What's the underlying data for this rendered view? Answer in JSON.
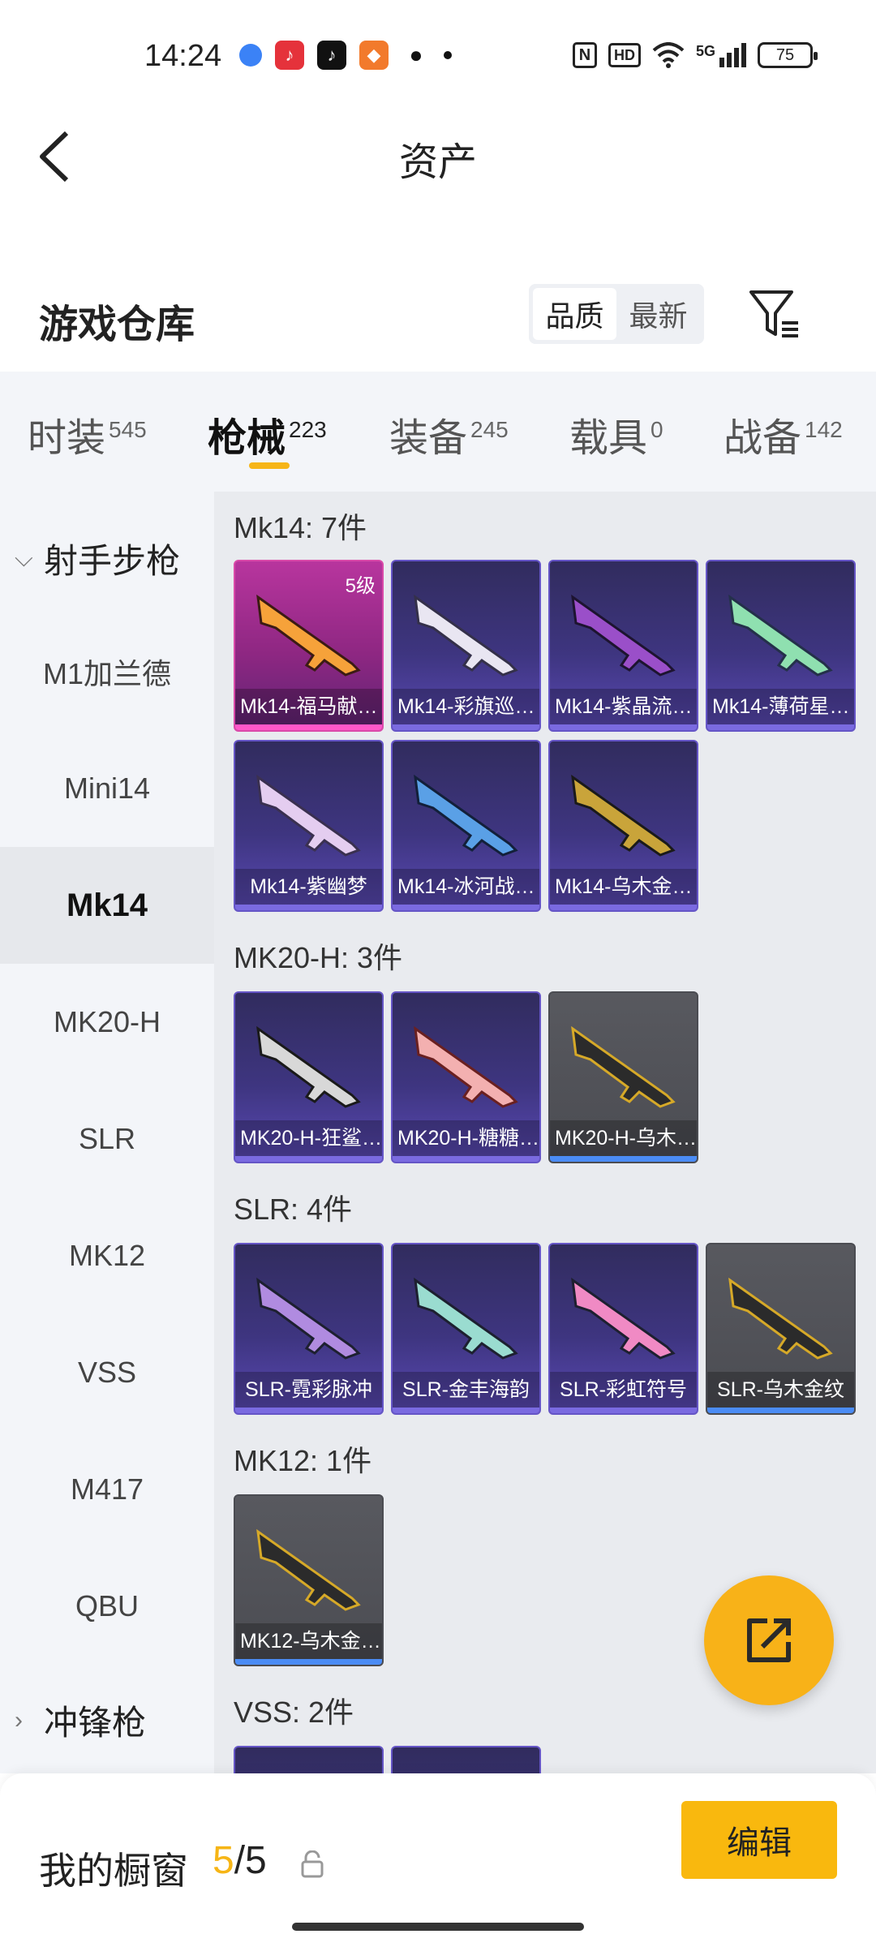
{
  "status": {
    "time": "14:24",
    "network": "5G",
    "hd": "HD",
    "nfc": "N",
    "battery": "75"
  },
  "nav": {
    "title": "资产"
  },
  "warehouse": {
    "title": "游戏仓库",
    "sort_quality": "品质",
    "sort_latest": "最新"
  },
  "tabs": [
    {
      "label": "时装",
      "count": "545"
    },
    {
      "label": "枪械",
      "count": "223"
    },
    {
      "label": "装备",
      "count": "245"
    },
    {
      "label": "载具",
      "count": "0"
    },
    {
      "label": "战备",
      "count": "142"
    }
  ],
  "sidebar": {
    "group_marksman": "射手步枪",
    "items": [
      "M1加兰德",
      "Mini14",
      "Mk14",
      "MK20-H",
      "SLR",
      "MK12",
      "VSS",
      "M417",
      "QBU"
    ],
    "group_smg": "冲锋枪"
  },
  "sections": [
    {
      "title": "Mk14: 7件",
      "cards": [
        {
          "name": "Mk14-福马献…",
          "level": "5级",
          "rarity": "pink"
        },
        {
          "name": "Mk14-彩旗巡…",
          "rarity": "purple"
        },
        {
          "name": "Mk14-紫晶流…",
          "rarity": "purple"
        },
        {
          "name": "Mk14-薄荷星…",
          "rarity": "purple"
        },
        {
          "name": "Mk14-紫幽梦",
          "rarity": "purple"
        },
        {
          "name": "Mk14-冰河战…",
          "rarity": "purple"
        },
        {
          "name": "Mk14-乌木金…",
          "rarity": "purple"
        }
      ]
    },
    {
      "title": "MK20-H: 3件",
      "cards": [
        {
          "name": "MK20-H-狂鲨…",
          "rarity": "purple"
        },
        {
          "name": "MK20-H-糖糖…",
          "rarity": "purple"
        },
        {
          "name": "MK20-H-乌木…",
          "rarity": "grey"
        }
      ]
    },
    {
      "title": "SLR: 4件",
      "cards": [
        {
          "name": "SLR-霓彩脉冲",
          "rarity": "purple"
        },
        {
          "name": "SLR-金丰海韵",
          "rarity": "purple"
        },
        {
          "name": "SLR-彩虹符号",
          "rarity": "purple"
        },
        {
          "name": "SLR-乌木金纹",
          "rarity": "grey"
        }
      ]
    },
    {
      "title": "MK12: 1件",
      "cards": [
        {
          "name": "MK12-乌木金…",
          "rarity": "grey"
        }
      ]
    },
    {
      "title": "VSS: 2件",
      "cards": []
    }
  ],
  "showcase": {
    "label": "我的橱窗",
    "current": "5",
    "total": "/5",
    "edit_label": "编辑"
  },
  "colors": {
    "accent": "#f6b516",
    "purple_card": "#3e3580",
    "pink_card": "#a72e91",
    "grey_card": "#505157"
  }
}
